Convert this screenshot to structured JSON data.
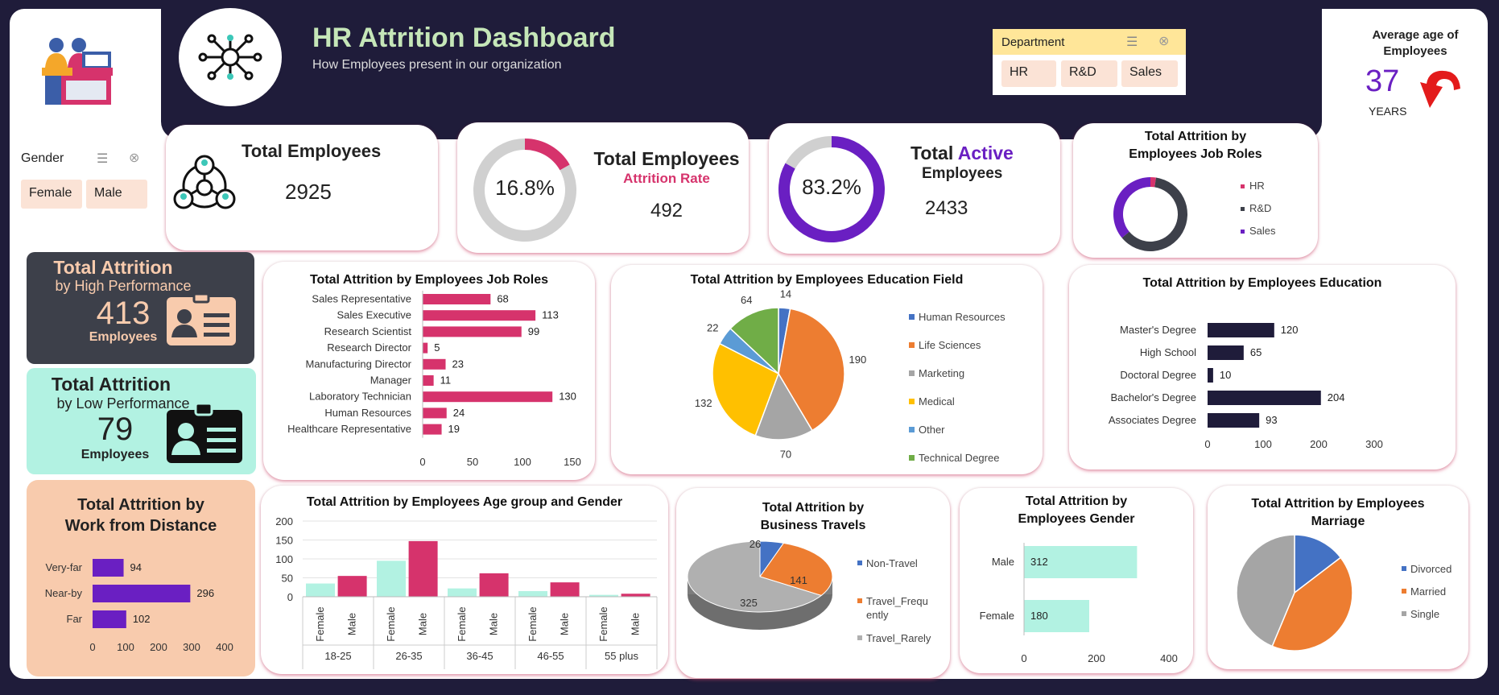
{
  "header": {
    "title": "HR Attrition Dashboard",
    "subtitle": "How Employees present in our organization"
  },
  "department_slicer": {
    "label": "Department",
    "options": [
      "HR",
      "R&D",
      "Sales"
    ]
  },
  "gender_slicer": {
    "label": "Gender",
    "options": [
      "Female",
      "Male"
    ]
  },
  "average_age": {
    "title": "Average age of Employees",
    "value": "37",
    "unit": "YEARS"
  },
  "kpis": {
    "total_employees": {
      "label": "Total Employees",
      "value": "2925"
    },
    "attrition": {
      "label": "Total Employees",
      "sublabel": "Attrition Rate",
      "rate": "16.8%",
      "rate_fraction": 0.168,
      "value": "492"
    },
    "active": {
      "label_prefix": "Total ",
      "label_highlight": "Active",
      "label_suffix": "Employees",
      "rate": "83.2%",
      "rate_fraction": 0.832,
      "value": "2433"
    }
  },
  "high_performance": {
    "title": "Total Attrition",
    "subtitle": "by High Performance",
    "value": "413",
    "unit": "Employees"
  },
  "low_performance": {
    "title": "Total Attrition",
    "subtitle": "by Low Performance",
    "value": "79",
    "unit": "Employees"
  },
  "colors": {
    "navy": "#1f1c3a",
    "crimson": "#d6336c",
    "purple": "#6a1fc2",
    "mint": "#b2f2e2",
    "peach": "#f8cbad",
    "slate": "#3d404a",
    "orange": "#ed7d31",
    "gray": "#a5a5a5",
    "blue": "#4472c4",
    "yellow": "#ffc000",
    "lightblue": "#5b9bd5",
    "green": "#70ad47"
  },
  "chart_data": [
    {
      "id": "dept_donut",
      "type": "pie",
      "title": "Total Attrition by Employees Job Roles",
      "categories": [
        "HR",
        "R&D",
        "Sales"
      ],
      "values": [
        12,
        303,
        177
      ]
    },
    {
      "id": "job_roles",
      "type": "bar",
      "title": "Total Attrition by Employees Job Roles",
      "categories": [
        "Sales Representative",
        "Sales Executive",
        "Research Scientist",
        "Research Director",
        "Manufacturing Director",
        "Manager",
        "Laboratory Technician",
        "Human Resources",
        "Healthcare Representative"
      ],
      "values": [
        68,
        113,
        99,
        5,
        23,
        11,
        130,
        24,
        19
      ],
      "xlim": [
        0,
        150
      ],
      "xticks": [
        "0",
        "50",
        "100",
        "150"
      ]
    },
    {
      "id": "education_field",
      "type": "pie",
      "title": "Total Attrition by Employees Education Field",
      "categories": [
        "Human Resources",
        "Life Sciences",
        "Marketing",
        "Medical",
        "Other",
        "Technical Degree"
      ],
      "values": [
        14,
        190,
        70,
        132,
        22,
        64
      ],
      "legend": "right"
    },
    {
      "id": "education",
      "type": "bar",
      "title": "Total Attrition by Employees Education",
      "categories": [
        "Master's Degree",
        "High School",
        "Doctoral Degree",
        "Bachelor's Degree",
        "Associates Degree"
      ],
      "values": [
        120,
        65,
        10,
        204,
        93
      ],
      "xlim": [
        0,
        300
      ],
      "xticks": [
        "0",
        "100",
        "200",
        "300"
      ]
    },
    {
      "id": "distance",
      "type": "bar",
      "title": "Total Attrition by Work from Distance",
      "categories": [
        "Very-far",
        "Near-by",
        "Far"
      ],
      "values": [
        94,
        296,
        102
      ],
      "xlim": [
        0,
        400
      ],
      "xticks": [
        "0",
        "100",
        "200",
        "300",
        "400"
      ]
    },
    {
      "id": "age_gender",
      "type": "bar",
      "title": "Total Attrition by Employees Age group and Gender",
      "groups": [
        "18-25",
        "26-35",
        "36-45",
        "46-55",
        "55 plus"
      ],
      "categories": [
        "Female",
        "Male"
      ],
      "series": [
        {
          "name": "Female",
          "values": [
            35,
            95,
            22,
            15,
            5
          ]
        },
        {
          "name": "Male",
          "values": [
            55,
            147,
            62,
            38,
            8
          ]
        }
      ],
      "ylim": [
        0,
        200
      ],
      "yticks": [
        "0",
        "50",
        "100",
        "150",
        "200"
      ]
    },
    {
      "id": "business_travel",
      "type": "pie",
      "title": "Total Attrition by Business Travels",
      "categories": [
        "Non-Travel",
        "Travel_Frequently",
        "Travel_Rarely"
      ],
      "legend_labels": [
        "Non-Travel",
        "Travel_Frequ",
        "ently",
        "Travel_Rarely"
      ],
      "values": [
        26,
        141,
        325
      ],
      "legend": "right"
    },
    {
      "id": "gender",
      "type": "bar",
      "title": "Total Attrition by Employees Gender",
      "categories": [
        "Male",
        "Female"
      ],
      "values": [
        312,
        180
      ],
      "xlim": [
        0,
        400
      ],
      "xticks": [
        "0",
        "200",
        "400"
      ]
    },
    {
      "id": "marriage",
      "type": "pie",
      "title": "Total Attrition by Employees Marriage",
      "categories": [
        "Divorced",
        "Married",
        "Single"
      ],
      "values": [
        72,
        205,
        215
      ],
      "legend": "right"
    }
  ]
}
